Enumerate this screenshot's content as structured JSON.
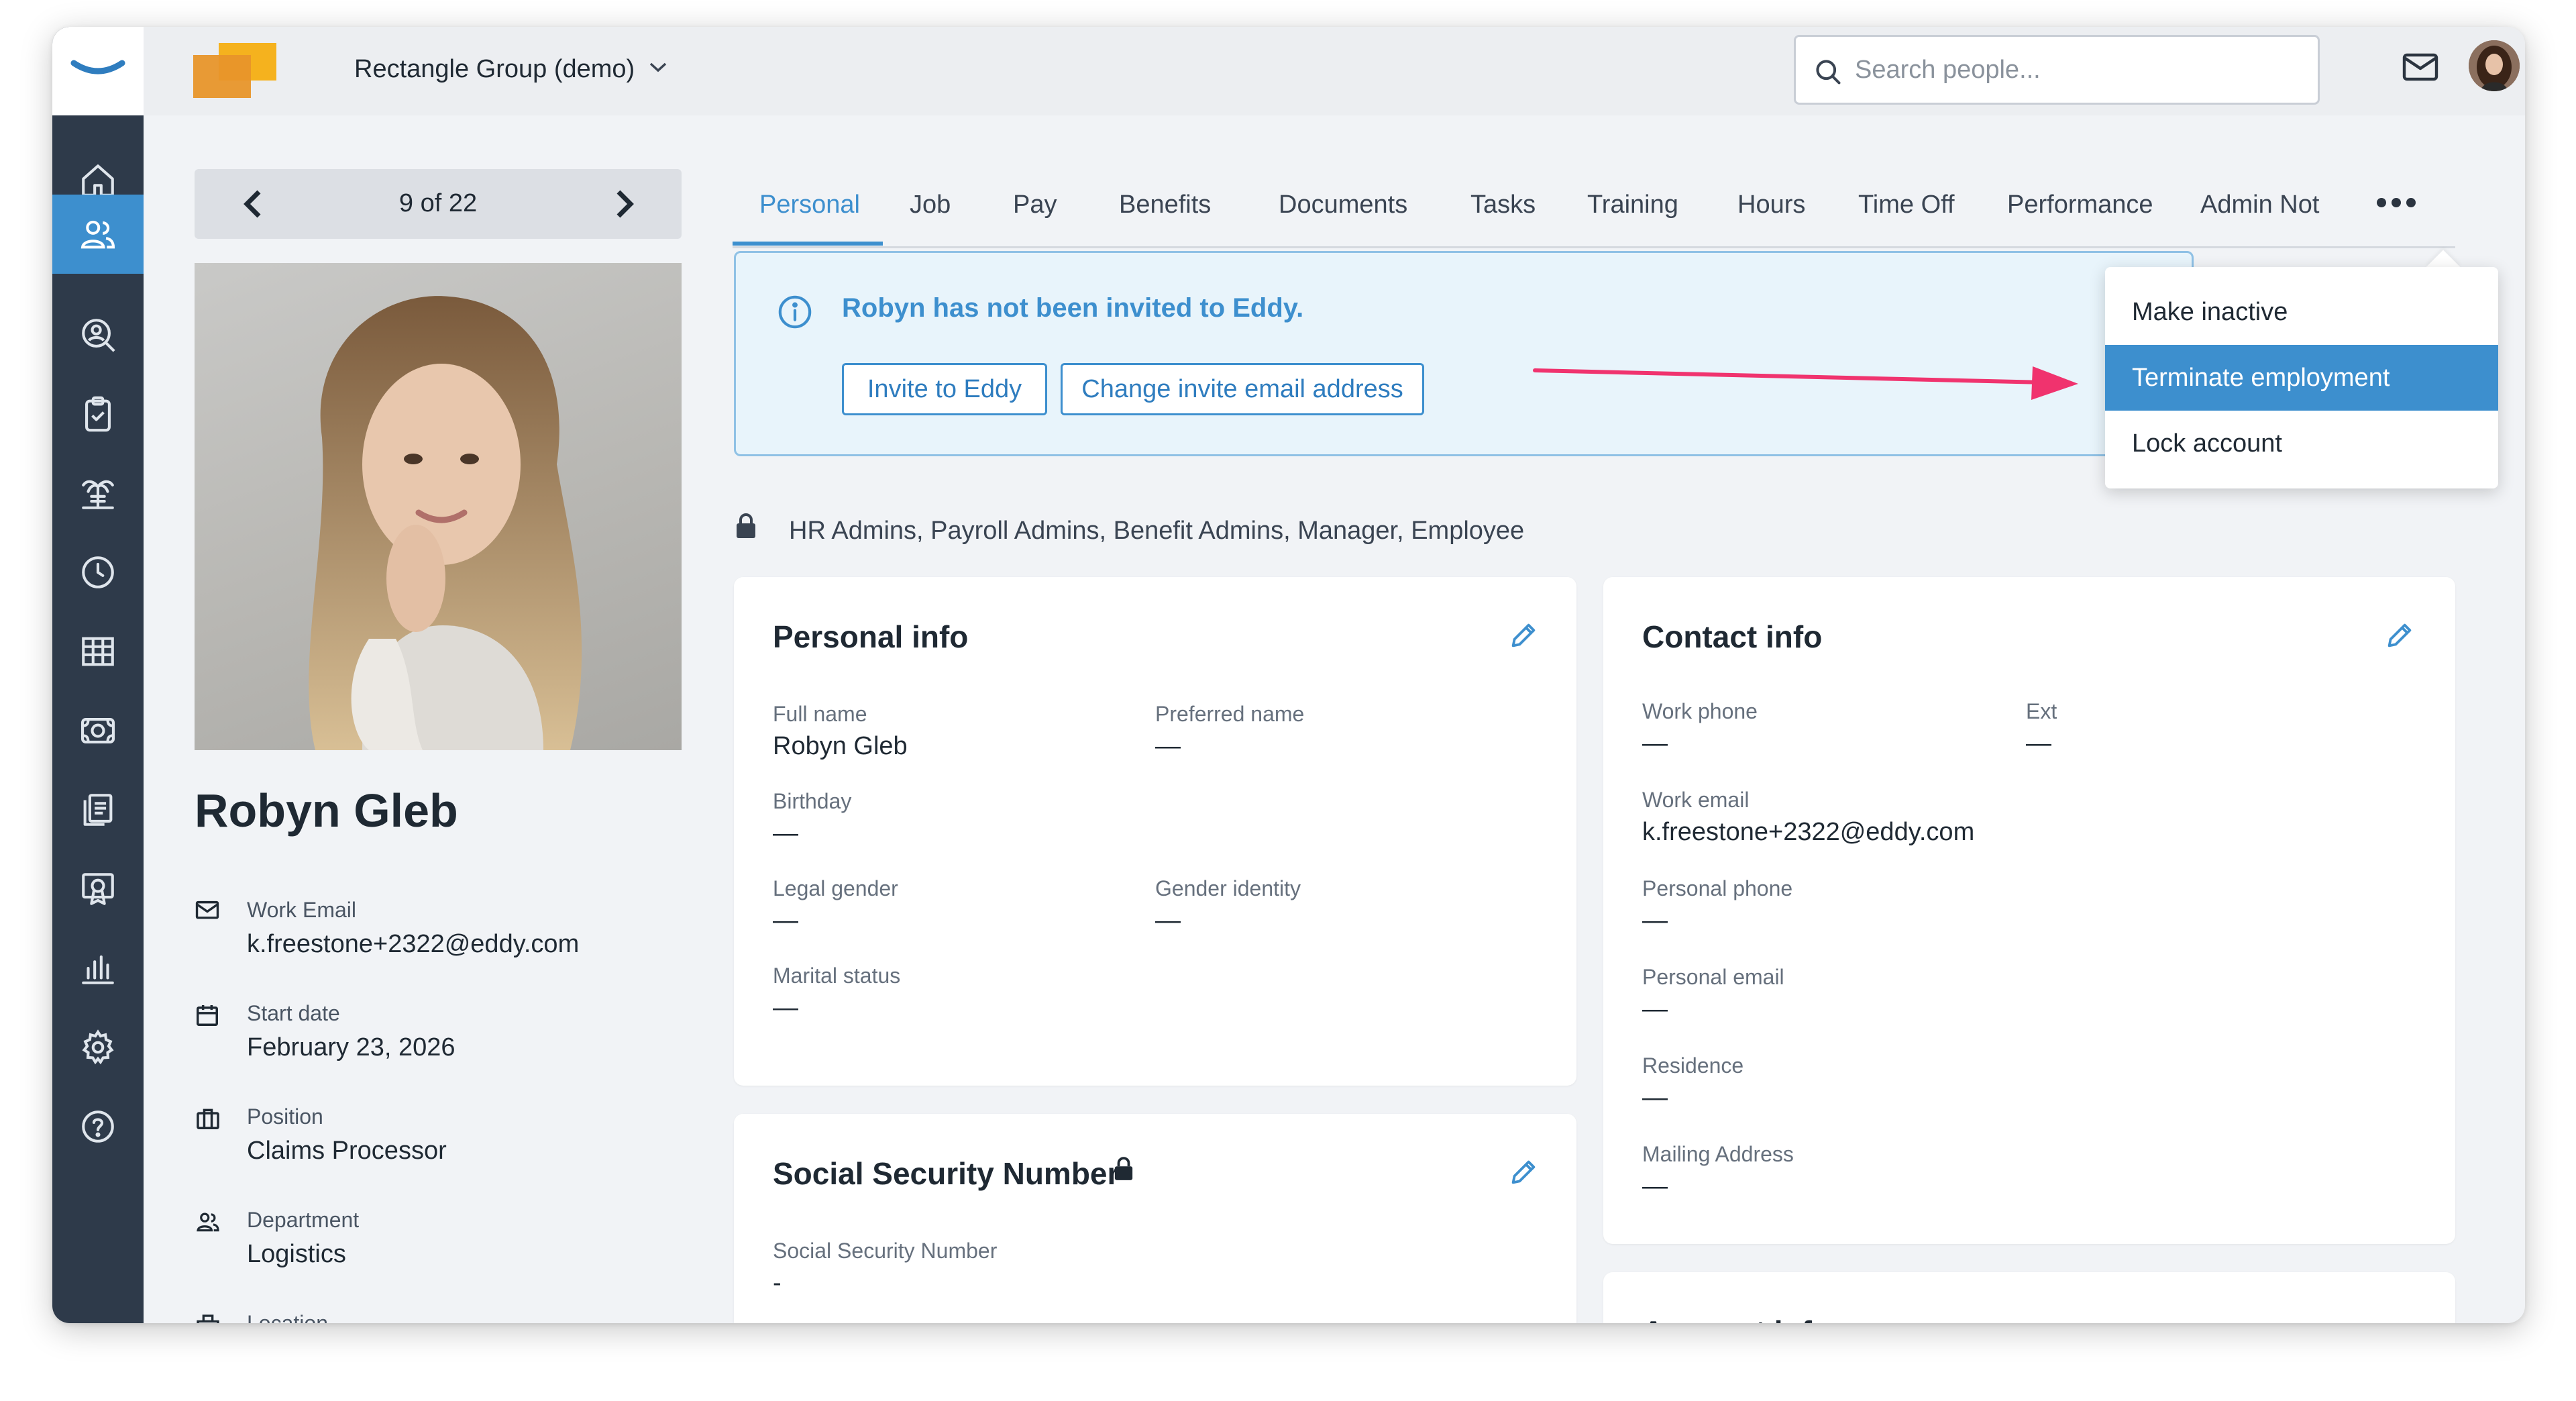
{
  "topbar": {
    "company_name": "Rectangle Group (demo)",
    "search_placeholder": "Search people..."
  },
  "sidebar": {
    "items": [
      {
        "icon": "home-icon"
      },
      {
        "icon": "people-icon",
        "active": true
      },
      {
        "icon": "person-search-icon"
      },
      {
        "icon": "clipboard-check-icon"
      },
      {
        "icon": "palm-tree-icon"
      },
      {
        "icon": "clock-icon"
      },
      {
        "icon": "table-icon"
      },
      {
        "icon": "money-icon"
      },
      {
        "icon": "documents-icon"
      },
      {
        "icon": "certificate-icon"
      },
      {
        "icon": "bar-chart-icon"
      },
      {
        "icon": "gear-icon"
      },
      {
        "icon": "help-icon"
      }
    ]
  },
  "pager": {
    "label": "9 of 22"
  },
  "profile": {
    "name": "Robyn Gleb",
    "details": [
      {
        "icon": "mail-icon",
        "label": "Work Email",
        "value": "k.freestone+2322@eddy.com"
      },
      {
        "icon": "calendar-icon",
        "label": "Start date",
        "value": "February 23, 2026"
      },
      {
        "icon": "briefcase-icon",
        "label": "Position",
        "value": "Claims Processor"
      },
      {
        "icon": "people-icon",
        "label": "Department",
        "value": "Logistics"
      },
      {
        "icon": "building-icon",
        "label": "Location",
        "value": ""
      }
    ]
  },
  "tabs": [
    "Personal",
    "Job",
    "Pay",
    "Benefits",
    "Documents",
    "Tasks",
    "Training",
    "Hours",
    "Time Off",
    "Performance",
    "Admin Not"
  ],
  "banner": {
    "title": "Robyn has not been invited to Eddy.",
    "invite_button": "Invite to Eddy",
    "change_button": "Change invite email address"
  },
  "roles": "HR Admins, Payroll Admins, Benefit Admins, Manager, Employee",
  "personal_info": {
    "title": "Personal info",
    "full_name_label": "Full name",
    "full_name": "Robyn Gleb",
    "preferred_name_label": "Preferred name",
    "preferred_name": "—",
    "birthday_label": "Birthday",
    "birthday": "—",
    "legal_gender_label": "Legal gender",
    "legal_gender": "—",
    "gender_identity_label": "Gender identity",
    "gender_identity": "—",
    "marital_status_label": "Marital status",
    "marital_status": "—"
  },
  "ssn": {
    "title": "Social Security Number",
    "label": "Social Security Number",
    "value": "-"
  },
  "contact_info": {
    "title": "Contact info",
    "work_phone_label": "Work phone",
    "work_phone": "—",
    "ext_label": "Ext",
    "ext": "—",
    "work_email_label": "Work email",
    "work_email": "k.freestone+2322@eddy.com",
    "personal_phone_label": "Personal phone",
    "personal_phone": "—",
    "personal_email_label": "Personal email",
    "personal_email": "—",
    "residence_label": "Residence",
    "residence": "—",
    "mailing_address_label": "Mailing Address",
    "mailing_address": "—"
  },
  "account_info": {
    "title": "Account info"
  },
  "menu": {
    "items": [
      "Make inactive",
      "Terminate employment",
      "Lock account"
    ],
    "highlighted": "Terminate employment"
  },
  "colors": {
    "accent": "#3d8fce",
    "sidebar": "#2e3a4a",
    "annotation_arrow": "#f0336e"
  }
}
